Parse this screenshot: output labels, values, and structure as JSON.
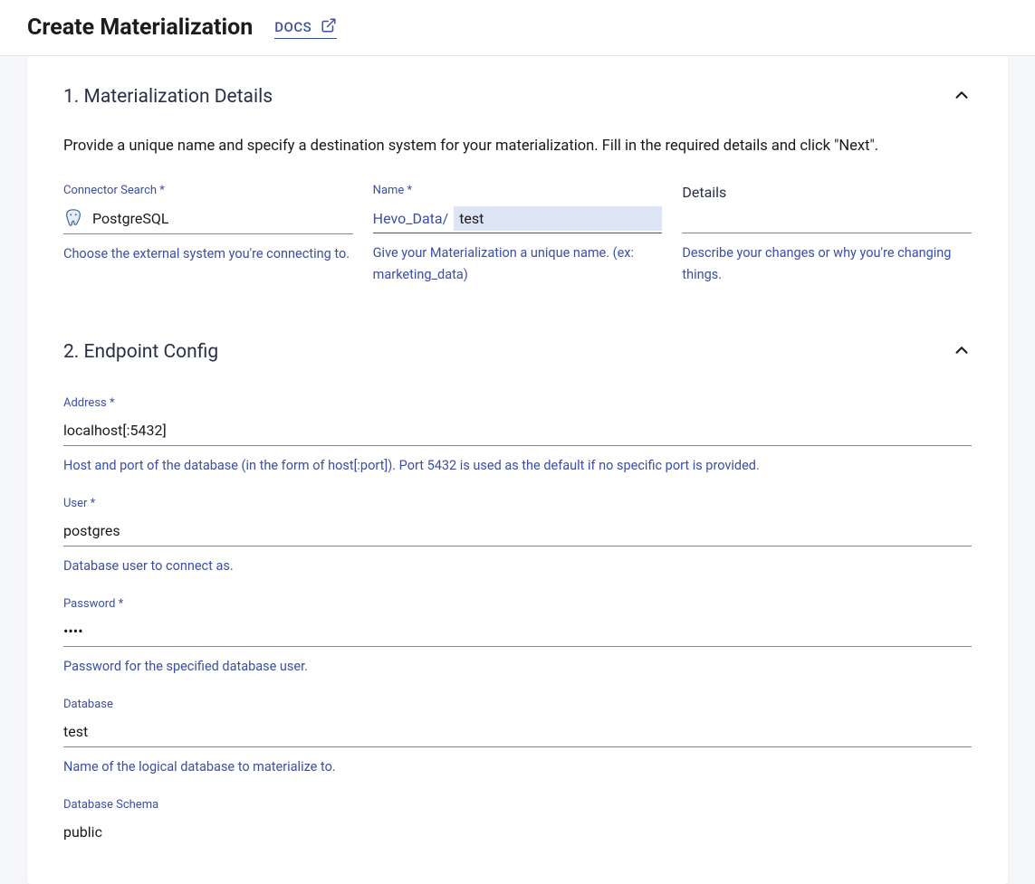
{
  "header": {
    "title": "Create Materialization",
    "docs_label": "DOCS"
  },
  "section1": {
    "title": "1. Materialization Details",
    "description": "Provide a unique name and specify a destination system for your materialization. Fill in the required details and click \"Next\".",
    "connector": {
      "label": "Connector Search *",
      "value": "PostgreSQL",
      "help": "Choose the external system you're connecting to."
    },
    "name": {
      "label": "Name *",
      "prefix": "Hevo_Data/",
      "value": "test",
      "help": "Give your Materialization a unique name. (ex: marketing_data)"
    },
    "details": {
      "label": "Details",
      "value": "",
      "help": "Describe your changes or why you're changing things."
    }
  },
  "section2": {
    "title": "2. Endpoint Config",
    "address": {
      "label": "Address *",
      "value": "localhost[:5432]",
      "help": "Host and port of the database (in the form of host[:port]). Port 5432 is used as the default if no specific port is provided."
    },
    "user": {
      "label": "User *",
      "value": "postgres",
      "help": "Database user to connect as."
    },
    "password": {
      "label": "Password *",
      "value": "••••",
      "help": "Password for the specified database user."
    },
    "database": {
      "label": "Database",
      "value": "test",
      "help": "Name of the logical database to materialize to."
    },
    "schema": {
      "label": "Database Schema",
      "value": "public"
    }
  }
}
